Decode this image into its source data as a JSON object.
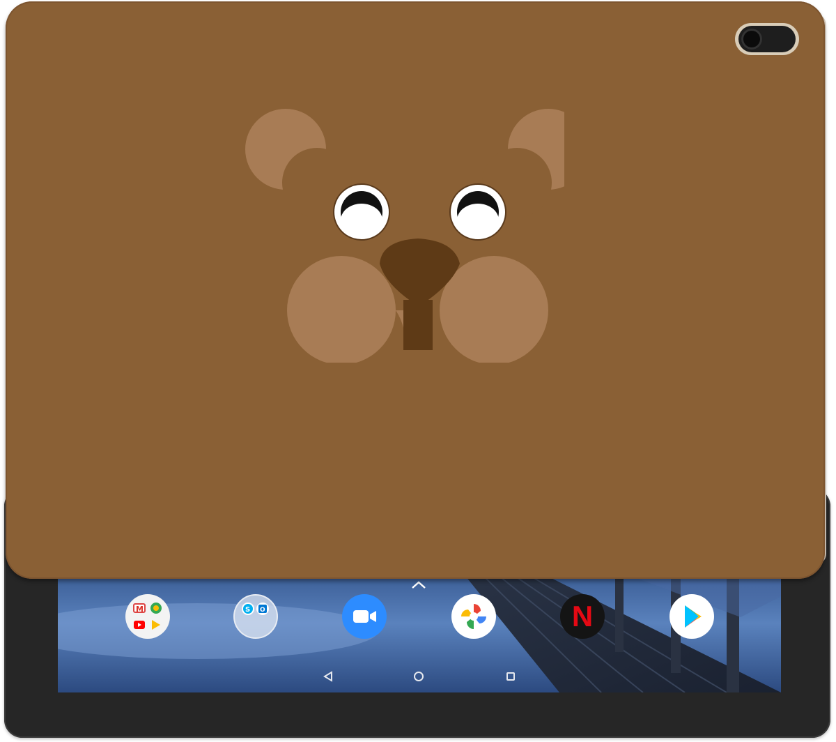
{
  "device": {
    "case_color": "#8a6035",
    "case_accent": "#a87c55",
    "nose_color": "#5e3a16",
    "screen_wallpaper": "pier-at-dusk"
  },
  "dock": {
    "apps": [
      {
        "name": "google-apps-folder",
        "icon": "folder-icon"
      },
      {
        "name": "skype-outlook-folder",
        "icon": "folder-icon"
      },
      {
        "name": "zoom",
        "icon": "video-camera-icon"
      },
      {
        "name": "photos",
        "icon": "pinwheel-icon"
      },
      {
        "name": "netflix",
        "icon": "netflix-icon",
        "label": "N"
      },
      {
        "name": "play-store",
        "icon": "play-store-icon"
      }
    ],
    "netflix_letter": "N"
  },
  "navigation": {
    "buttons": [
      "back-icon",
      "home-icon",
      "recents-icon"
    ]
  }
}
